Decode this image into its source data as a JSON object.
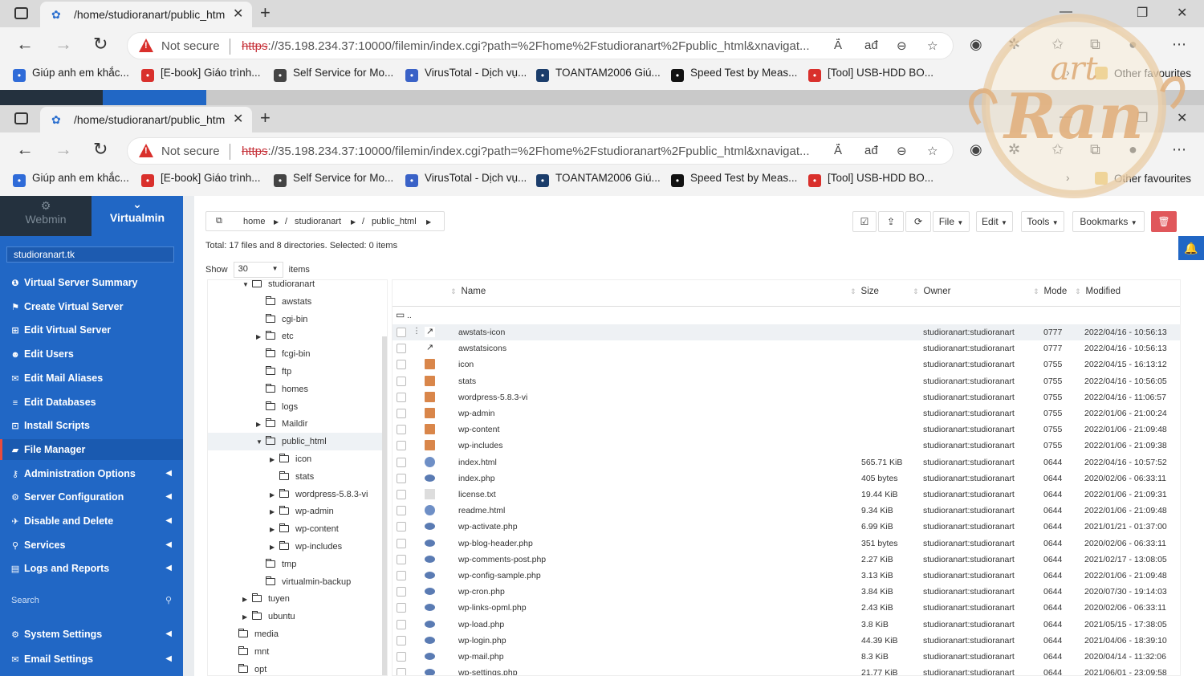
{
  "browser": {
    "tab_title": "/home/studioranart/public_html",
    "not_secure": "Not secure",
    "url_scheme": "https",
    "url_rest": "://35.198.234.37:10000/filemin/index.cgi?path=%2Fhome%2Fstudioranart%2Fpublic_html&xnavigat...",
    "read_aloud": "Ä́",
    "translate": "ađ",
    "favorites": [
      {
        "label": "Giúp anh em khắc...",
        "icon_color": "#2f6bd8"
      },
      {
        "label": "[E-book] Giáo trình...",
        "icon_color": "#d9302c"
      },
      {
        "label": "Self Service for Mo...",
        "icon_color": "#444"
      },
      {
        "label": "VirusTotal - Dịch vụ...",
        "icon_color": "#3a62c7"
      },
      {
        "label": "TOANTAM2006 Giú...",
        "icon_color": "#1b3d6b"
      },
      {
        "label": "Speed Test by Meas...",
        "icon_color": "#111"
      },
      {
        "label": "[Tool] USB-HDD BO...",
        "icon_color": "#d9302c"
      }
    ],
    "other_favourites": "Other favourites"
  },
  "sidebar": {
    "tab_webmin": "Webmin",
    "tab_virtualmin": "Virtualmin",
    "domain": "studioranart.tk",
    "items": [
      {
        "label": "Virtual Server Summary",
        "icon": "info-icon",
        "glyph": "❶",
        "arrow": false
      },
      {
        "label": "Create Virtual Server",
        "icon": "create-icon",
        "glyph": "⚑",
        "arrow": false
      },
      {
        "label": "Edit Virtual Server",
        "icon": "edit-server-icon",
        "glyph": "⊞",
        "arrow": false
      },
      {
        "label": "Edit Users",
        "icon": "users-icon",
        "glyph": "☻",
        "arrow": false
      },
      {
        "label": "Edit Mail Aliases",
        "icon": "mail-aliases-icon",
        "glyph": "✉",
        "arrow": false
      },
      {
        "label": "Edit Databases",
        "icon": "database-icon",
        "glyph": "≡",
        "arrow": false
      },
      {
        "label": "Install Scripts",
        "icon": "scripts-icon",
        "glyph": "⊡",
        "arrow": false
      },
      {
        "label": "File Manager",
        "icon": "folder-icon",
        "glyph": "▰",
        "arrow": false,
        "active": true
      },
      {
        "label": "Administration Options",
        "icon": "key-icon",
        "glyph": "⚷",
        "arrow": true
      },
      {
        "label": "Server Configuration",
        "icon": "gear-icon",
        "glyph": "⚙",
        "arrow": true
      },
      {
        "label": "Disable and Delete",
        "icon": "rocket-icon",
        "glyph": "✈",
        "arrow": true
      },
      {
        "label": "Services",
        "icon": "services-icon",
        "glyph": "⚲",
        "arrow": true
      },
      {
        "label": "Logs and Reports",
        "icon": "logs-icon",
        "glyph": "▤",
        "arrow": true
      }
    ],
    "search": "Search",
    "bottom_items": [
      {
        "label": "System Settings",
        "icon": "gear-icon",
        "glyph": "⚙"
      },
      {
        "label": "Email Settings",
        "icon": "email-icon",
        "glyph": "✉"
      }
    ]
  },
  "filemanager": {
    "breadcrumb": [
      "home",
      "studioranart",
      "public_html"
    ],
    "toolbar": {
      "file": "File",
      "edit": "Edit",
      "tools": "Tools",
      "bookmarks": "Bookmarks"
    },
    "total": "Total: 17 files and 8 directories. Selected: 0 items",
    "show_label": "Show",
    "show_value": "30",
    "items_label": "items",
    "tree": [
      {
        "label": "studioranart",
        "toggle": "▼",
        "open": true
      },
      {
        "label": "awstats",
        "toggle": ""
      },
      {
        "label": "cgi-bin",
        "toggle": ""
      },
      {
        "label": "etc",
        "toggle": "▶"
      },
      {
        "label": "fcgi-bin",
        "toggle": ""
      },
      {
        "label": "ftp",
        "toggle": ""
      },
      {
        "label": "homes",
        "toggle": ""
      },
      {
        "label": "logs",
        "toggle": ""
      },
      {
        "label": "Maildir",
        "toggle": "▶"
      },
      {
        "label": "public_html",
        "toggle": "▼",
        "open": true,
        "selected": true
      },
      {
        "label": "icon",
        "toggle": "▶"
      },
      {
        "label": "stats",
        "toggle": ""
      },
      {
        "label": "wordpress-5.8.3-vi",
        "toggle": "▶"
      },
      {
        "label": "wp-admin",
        "toggle": "▶"
      },
      {
        "label": "wp-content",
        "toggle": "▶"
      },
      {
        "label": "wp-includes",
        "toggle": "▶"
      },
      {
        "label": "tmp",
        "toggle": ""
      },
      {
        "label": "virtualmin-backup",
        "toggle": ""
      },
      {
        "label": "tuyen",
        "toggle": "▶"
      },
      {
        "label": "ubuntu",
        "toggle": "▶"
      },
      {
        "label": "media",
        "toggle": ""
      },
      {
        "label": "mnt",
        "toggle": ""
      },
      {
        "label": "opt",
        "toggle": ""
      }
    ],
    "columns": {
      "name": "Name",
      "size": "Size",
      "owner": "Owner",
      "mode": "Mode",
      "modified": "Modified"
    },
    "parent": "..",
    "rows": [
      {
        "name": "awstats-icon",
        "type": "link",
        "size": "",
        "owner": "studioranart:studioranart",
        "mode": "0777",
        "modified": "2022/04/16 - 10:56:13"
      },
      {
        "name": "awstatsicons",
        "type": "link",
        "size": "",
        "owner": "studioranart:studioranart",
        "mode": "0777",
        "modified": "2022/04/16 - 10:56:13"
      },
      {
        "name": "icon",
        "type": "folder",
        "size": "",
        "owner": "studioranart:studioranart",
        "mode": "0755",
        "modified": "2022/04/15 - 16:13:12"
      },
      {
        "name": "stats",
        "type": "folder",
        "size": "",
        "owner": "studioranart:studioranart",
        "mode": "0755",
        "modified": "2022/04/16 - 10:56:05"
      },
      {
        "name": "wordpress-5.8.3-vi",
        "type": "folder",
        "size": "",
        "owner": "studioranart:studioranart",
        "mode": "0755",
        "modified": "2022/04/16 - 11:06:57"
      },
      {
        "name": "wp-admin",
        "type": "folder",
        "size": "",
        "owner": "studioranart:studioranart",
        "mode": "0755",
        "modified": "2022/01/06 - 21:00:24"
      },
      {
        "name": "wp-content",
        "type": "folder",
        "size": "",
        "owner": "studioranart:studioranart",
        "mode": "0755",
        "modified": "2022/01/06 - 21:09:48"
      },
      {
        "name": "wp-includes",
        "type": "folder",
        "size": "",
        "owner": "studioranart:studioranart",
        "mode": "0755",
        "modified": "2022/01/06 - 21:09:38"
      },
      {
        "name": "index.html",
        "type": "html",
        "size": "565.71 KiB",
        "owner": "studioranart:studioranart",
        "mode": "0644",
        "modified": "2022/04/16 - 10:57:52"
      },
      {
        "name": "index.php",
        "type": "php",
        "size": "405 bytes",
        "owner": "studioranart:studioranart",
        "mode": "0644",
        "modified": "2020/02/06 - 06:33:11"
      },
      {
        "name": "license.txt",
        "type": "txt",
        "size": "19.44 KiB",
        "owner": "studioranart:studioranart",
        "mode": "0644",
        "modified": "2022/01/06 - 21:09:31"
      },
      {
        "name": "readme.html",
        "type": "html",
        "size": "9.34 KiB",
        "owner": "studioranart:studioranart",
        "mode": "0644",
        "modified": "2022/01/06 - 21:09:48"
      },
      {
        "name": "wp-activate.php",
        "type": "php",
        "size": "6.99 KiB",
        "owner": "studioranart:studioranart",
        "mode": "0644",
        "modified": "2021/01/21 - 01:37:00"
      },
      {
        "name": "wp-blog-header.php",
        "type": "php",
        "size": "351 bytes",
        "owner": "studioranart:studioranart",
        "mode": "0644",
        "modified": "2020/02/06 - 06:33:11"
      },
      {
        "name": "wp-comments-post.php",
        "type": "php",
        "size": "2.27 KiB",
        "owner": "studioranart:studioranart",
        "mode": "0644",
        "modified": "2021/02/17 - 13:08:05"
      },
      {
        "name": "wp-config-sample.php",
        "type": "php",
        "size": "3.13 KiB",
        "owner": "studioranart:studioranart",
        "mode": "0644",
        "modified": "2022/01/06 - 21:09:48"
      },
      {
        "name": "wp-cron.php",
        "type": "php",
        "size": "3.84 KiB",
        "owner": "studioranart:studioranart",
        "mode": "0644",
        "modified": "2020/07/30 - 19:14:03"
      },
      {
        "name": "wp-links-opml.php",
        "type": "php",
        "size": "2.43 KiB",
        "owner": "studioranart:studioranart",
        "mode": "0644",
        "modified": "2020/02/06 - 06:33:11"
      },
      {
        "name": "wp-load.php",
        "type": "php",
        "size": "3.8 KiB",
        "owner": "studioranart:studioranart",
        "mode": "0644",
        "modified": "2021/05/15 - 17:38:05"
      },
      {
        "name": "wp-login.php",
        "type": "php",
        "size": "44.39 KiB",
        "owner": "studioranart:studioranart",
        "mode": "0644",
        "modified": "2021/04/06 - 18:39:10"
      },
      {
        "name": "wp-mail.php",
        "type": "php",
        "size": "8.3 KiB",
        "owner": "studioranart:studioranart",
        "mode": "0644",
        "modified": "2020/04/14 - 11:32:06"
      },
      {
        "name": "wp-settings.php",
        "type": "php",
        "size": "21.77 KiB",
        "owner": "studioranart:studioranart",
        "mode": "0644",
        "modified": "2021/06/01 - 23:09:58"
      }
    ]
  },
  "watermark": {
    "text_top": "art",
    "text_main": "Ran"
  }
}
